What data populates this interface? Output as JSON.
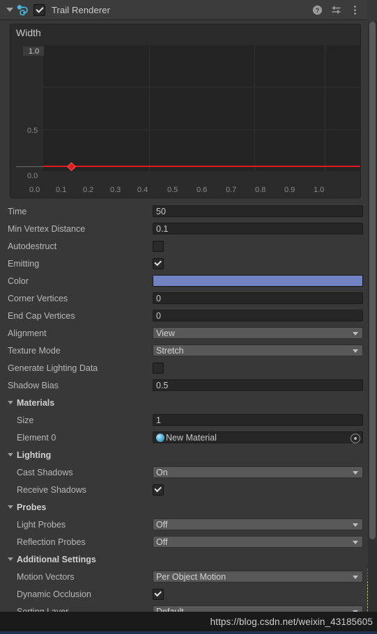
{
  "component": {
    "title": "Trail Renderer",
    "enabled": true,
    "expanded": true,
    "icon": "trail-renderer-icon",
    "header_icons": [
      "help-icon",
      "preset-icon",
      "more-menu-icon"
    ]
  },
  "curve": {
    "title": "Width",
    "chart_data": {
      "type": "line",
      "title": "Width",
      "xlabel": "",
      "ylabel": "",
      "x": [
        0.0,
        1.0
      ],
      "values": [
        0.0,
        0.0
      ],
      "xticks": [
        "0.0",
        "0.1",
        "0.2",
        "0.3",
        "0.4",
        "0.5",
        "0.6",
        "0.7",
        "0.8",
        "0.9",
        "1.0"
      ],
      "yticks": [
        "0.0",
        "0.5",
        "1.0"
      ],
      "xlim": [
        0.0,
        1.0
      ],
      "ylim": [
        0.0,
        1.0
      ],
      "grid": true,
      "curve_color": "#e11b1b",
      "keyframes": [
        {
          "x": 0.1,
          "y": 0.0
        }
      ]
    }
  },
  "properties": [
    {
      "label": "Time",
      "type": "text",
      "value": "50",
      "indent": 0
    },
    {
      "label": "Min Vertex Distance",
      "type": "text",
      "value": "0.1",
      "indent": 0
    },
    {
      "label": "Autodestruct",
      "type": "checkbox",
      "value": false,
      "indent": 0
    },
    {
      "label": "Emitting",
      "type": "checkbox",
      "value": true,
      "indent": 0
    },
    {
      "label": "Color",
      "type": "color",
      "value": "#7283c4",
      "indent": 0
    },
    {
      "label": "Corner Vertices",
      "type": "text",
      "value": "0",
      "indent": 0
    },
    {
      "label": "End Cap Vertices",
      "type": "text",
      "value": "0",
      "indent": 0
    },
    {
      "label": "Alignment",
      "type": "popup",
      "value": "View",
      "indent": 0
    },
    {
      "label": "Texture Mode",
      "type": "popup",
      "value": "Stretch",
      "indent": 0
    },
    {
      "label": "Generate Lighting Data",
      "type": "checkbox",
      "value": false,
      "indent": 0
    },
    {
      "label": "Shadow Bias",
      "type": "text",
      "value": "0.5",
      "indent": 0
    },
    {
      "label": "Materials",
      "type": "section",
      "indent": 0
    },
    {
      "label": "Size",
      "type": "text",
      "value": "1",
      "indent": 1
    },
    {
      "label": "Element 0",
      "type": "object",
      "value": "New Material",
      "indent": 1
    },
    {
      "label": "Lighting",
      "type": "section",
      "indent": 0
    },
    {
      "label": "Cast Shadows",
      "type": "popup",
      "value": "On",
      "indent": 1
    },
    {
      "label": "Receive Shadows",
      "type": "checkbox",
      "value": true,
      "indent": 1
    },
    {
      "label": "Probes",
      "type": "section",
      "indent": 0
    },
    {
      "label": "Light Probes",
      "type": "popup",
      "value": "Off",
      "indent": 1
    },
    {
      "label": "Reflection Probes",
      "type": "popup",
      "value": "Off",
      "indent": 1
    },
    {
      "label": "Additional Settings",
      "type": "section",
      "indent": 0
    },
    {
      "label": "Motion Vectors",
      "type": "popup",
      "value": "Per Object Motion",
      "indent": 1
    },
    {
      "label": "Dynamic Occlusion",
      "type": "checkbox",
      "value": true,
      "indent": 1
    },
    {
      "label": "Sorting Layer",
      "type": "popup",
      "value": "Default",
      "indent": 1
    }
  ],
  "watermark": {
    "url": "https://blog.csdn.net/weixin_43185605"
  }
}
